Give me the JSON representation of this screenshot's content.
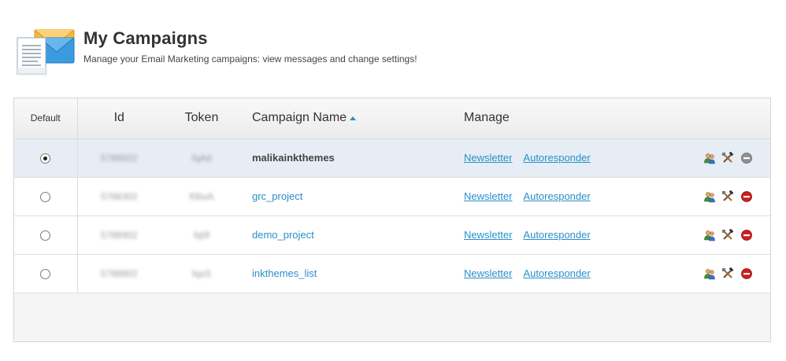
{
  "header": {
    "title": "My Campaigns",
    "subtitle": "Manage your Email Marketing campaigns: view messages and change settings!"
  },
  "table": {
    "columns": {
      "default": "Default",
      "id": "Id",
      "token": "Token",
      "name": "Campaign Name",
      "manage": "Manage"
    },
    "rows": [
      {
        "selected": true,
        "id": "5788502",
        "token": "fqAd",
        "name": "malikainkthemes",
        "newsletter": "Newsletter",
        "autoresponder": "Autoresponder"
      },
      {
        "selected": false,
        "id": "5788302",
        "token": "f0bvA",
        "name": "grc_project",
        "newsletter": "Newsletter",
        "autoresponder": "Autoresponder"
      },
      {
        "selected": false,
        "id": "5788902",
        "token": "fq0f",
        "name": "demo_project",
        "newsletter": "Newsletter",
        "autoresponder": "Autoresponder"
      },
      {
        "selected": false,
        "id": "5788802",
        "token": "fqsS",
        "name": "inkthemes_list",
        "newsletter": "Newsletter",
        "autoresponder": "Autoresponder"
      }
    ],
    "action_icons": [
      "users-icon",
      "tools-icon",
      "delete-icon"
    ]
  },
  "colors": {
    "link": "#2a8fc9",
    "selected_row": "#e6edf4",
    "delete": "#cc1f1f"
  }
}
